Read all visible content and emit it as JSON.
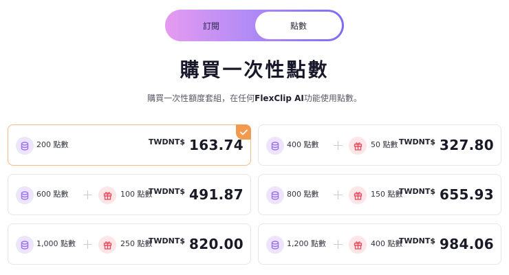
{
  "toggle": {
    "subscription_label": "訂閱",
    "points_label": "點數"
  },
  "title": "購買一次性點數",
  "subtitle": {
    "before": "購買一次性額度套組，在任何",
    "brand": "FlexClip AI",
    "after": "功能使用點數。"
  },
  "currency": "TWDNT$",
  "plans": [
    {
      "points": "200 點數",
      "bonus": "",
      "price": "163.74",
      "selected": true
    },
    {
      "points": "400 點數",
      "bonus": "50 點數",
      "price": "327.80",
      "selected": false
    },
    {
      "points": "600 點數",
      "bonus": "100 點數",
      "price": "491.87",
      "selected": false
    },
    {
      "points": "800 點數",
      "bonus": "150 點數",
      "price": "655.93",
      "selected": false
    },
    {
      "points": "1,000 點數",
      "bonus": "250 點數",
      "price": "820.00",
      "selected": false
    },
    {
      "points": "1,200 點數",
      "bonus": "400 點數",
      "price": "984.06",
      "selected": false
    }
  ],
  "colors": {
    "accent_orange": "#f29a4e",
    "coin_purple": "#9b6ff0",
    "gift_red": "#e8485c"
  },
  "icons": {
    "coin": "coin-stack-icon",
    "gift": "gift-box-icon",
    "check": "check-icon"
  }
}
